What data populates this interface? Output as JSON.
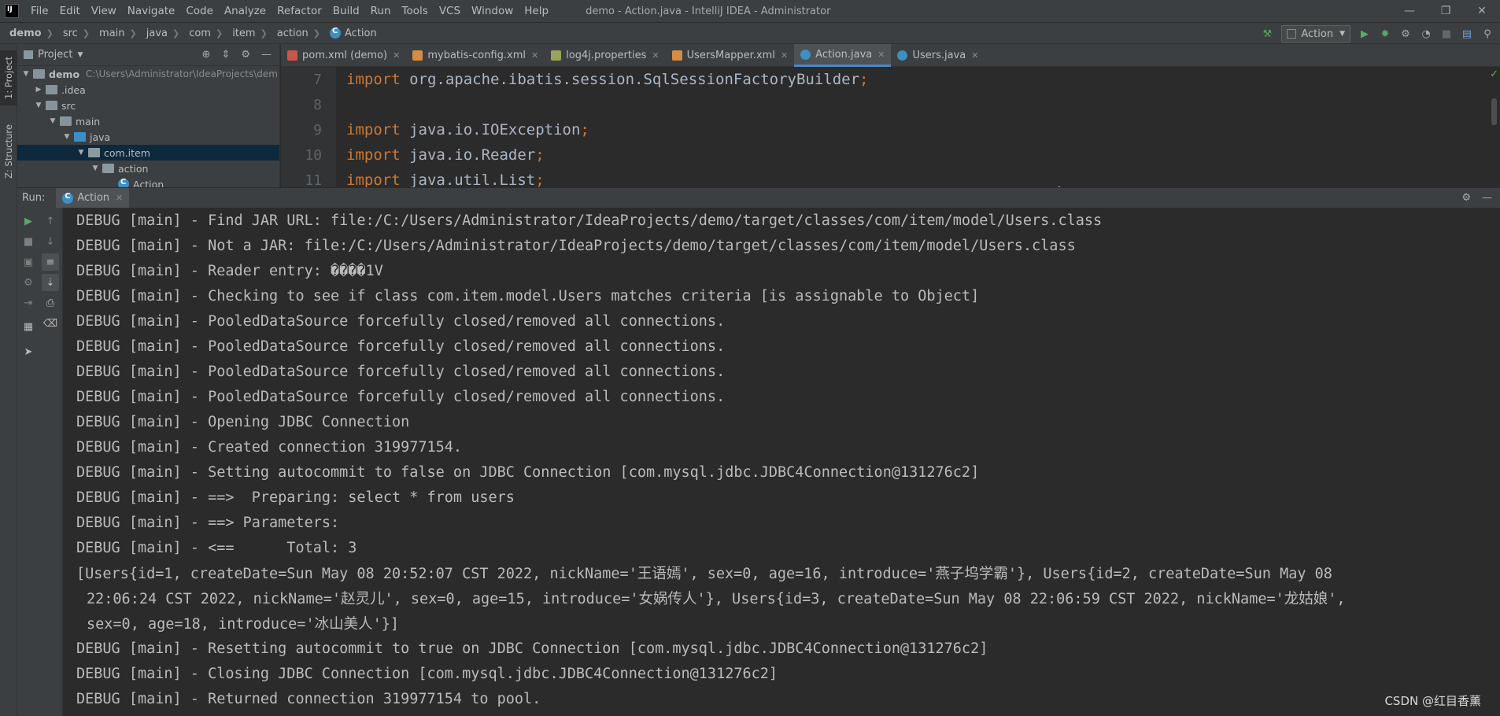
{
  "window": {
    "title": "demo - Action.java - IntelliJ IDEA - Administrator"
  },
  "menu": [
    "File",
    "Edit",
    "View",
    "Navigate",
    "Code",
    "Analyze",
    "Refactor",
    "Build",
    "Run",
    "Tools",
    "VCS",
    "Window",
    "Help"
  ],
  "breadcrumb": [
    "demo",
    "src",
    "main",
    "java",
    "com",
    "item",
    "action",
    "Action"
  ],
  "run_config": "Action",
  "project_panel": {
    "title": "Project",
    "tree": [
      {
        "label": "demo",
        "hint": "C:\\Users\\Administrator\\IdeaProjects\\dem"
      },
      {
        "label": ".idea",
        "hint": ""
      },
      {
        "label": "src",
        "hint": ""
      },
      {
        "label": "main",
        "hint": ""
      },
      {
        "label": "java",
        "hint": ""
      },
      {
        "label": "com.item",
        "hint": ""
      },
      {
        "label": "action",
        "hint": ""
      },
      {
        "label": "Action",
        "hint": ""
      }
    ]
  },
  "left_stripe": {
    "project": "1: Project",
    "structure": "Z: Structure"
  },
  "editor_tabs": [
    {
      "label": "pom.xml (demo)",
      "icon": "maven-icon"
    },
    {
      "label": "mybatis-config.xml",
      "icon": "xml-icon"
    },
    {
      "label": "log4j.properties",
      "icon": "properties-icon"
    },
    {
      "label": "UsersMapper.xml",
      "icon": "xml-icon"
    },
    {
      "label": "Action.java",
      "icon": "java-class-icon"
    },
    {
      "label": "Users.java",
      "icon": "java-class-icon"
    }
  ],
  "code": [
    {
      "no": "7",
      "kw": "import",
      "rest": " org.apache.ibatis.session.SqlSessionFactoryBuilder",
      "semi": ";"
    },
    {
      "no": "8",
      "kw": "",
      "rest": "",
      "semi": ""
    },
    {
      "no": "9",
      "kw": "import",
      "rest": " java.io.IOException",
      "semi": ";"
    },
    {
      "no": "10",
      "kw": "import",
      "rest": " java.io.Reader",
      "semi": ";"
    },
    {
      "no": "11",
      "kw": "import",
      "rest": " java.util.List",
      "semi": ";"
    }
  ],
  "run_panel": {
    "title": "Run:",
    "tab": "Action"
  },
  "console": [
    "DEBUG [main] - Find JAR URL: file:/C:/Users/Administrator/IdeaProjects/demo/target/classes/com/item/model/Users.class",
    "DEBUG [main] - Not a JAR: file:/C:/Users/Administrator/IdeaProjects/demo/target/classes/com/item/model/Users.class",
    "DEBUG [main] - Reader entry: ����1V",
    "DEBUG [main] - Checking to see if class com.item.model.Users matches criteria [is assignable to Object]",
    "DEBUG [main] - PooledDataSource forcefully closed/removed all connections.",
    "DEBUG [main] - PooledDataSource forcefully closed/removed all connections.",
    "DEBUG [main] - PooledDataSource forcefully closed/removed all connections.",
    "DEBUG [main] - PooledDataSource forcefully closed/removed all connections.",
    "DEBUG [main] - Opening JDBC Connection",
    "DEBUG [main] - Created connection 319977154.",
    "DEBUG [main] - Setting autocommit to false on JDBC Connection [com.mysql.jdbc.JDBC4Connection@131276c2]",
    "DEBUG [main] - ==>  Preparing: select * from users",
    "DEBUG [main] - ==> Parameters: ",
    "DEBUG [main] - <==      Total: 3",
    "[Users{id=1, createDate=Sun May 08 20:52:07 CST 2022, nickName='王语嫣', sex=0, age=16, introduce='燕子坞学霸'}, Users{id=2, createDate=Sun May 08",
    "22:06:24 CST 2022, nickName='赵灵儿', sex=0, age=15, introduce='女娲传人'}, Users{id=3, createDate=Sun May 08 22:06:59 CST 2022, nickName='龙姑娘',",
    "sex=0, age=18, introduce='冰山美人'}]",
    "DEBUG [main] - Resetting autocommit to true on JDBC Connection [com.mysql.jdbc.JDBC4Connection@131276c2]",
    "DEBUG [main] - Closing JDBC Connection [com.mysql.jdbc.JDBC4Connection@131276c2]",
    "DEBUG [main] - Returned connection 319977154 to pool."
  ],
  "watermark": "CSDN @红目香薰",
  "colors": {
    "accent": "#4a88c7",
    "run_green": "#59a869",
    "keyword": "#cc7832"
  }
}
